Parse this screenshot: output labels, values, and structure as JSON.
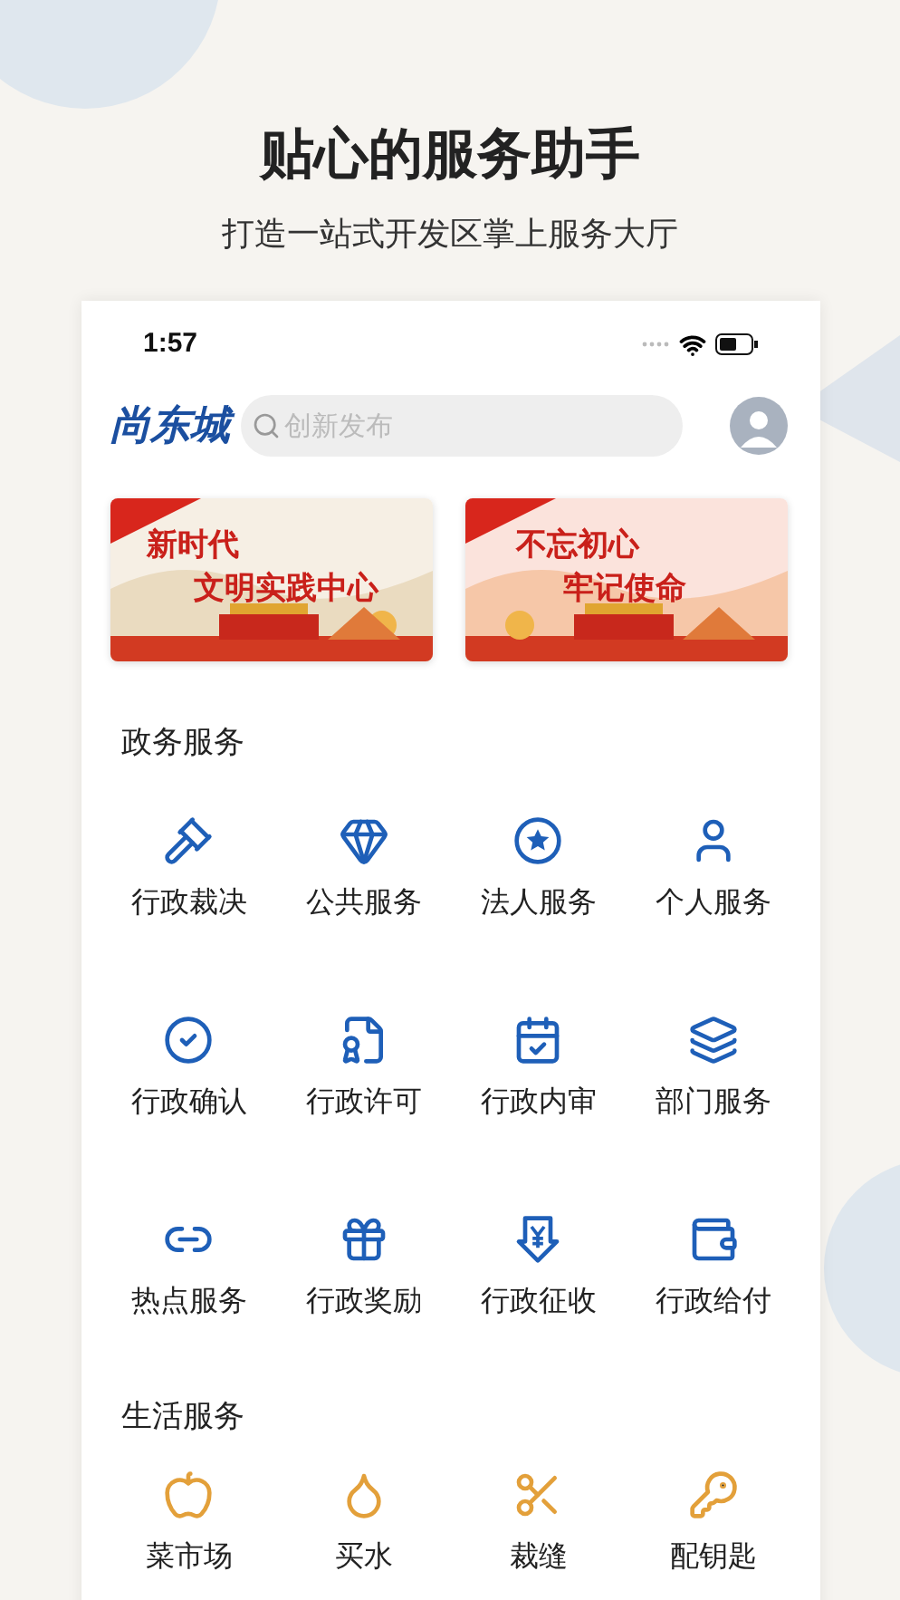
{
  "headline": "贴心的服务助手",
  "subtitle": "打造一站式开发区掌上服务大厅",
  "status_bar": {
    "time": "1:57"
  },
  "header": {
    "logo": "尚东城",
    "search": {
      "placeholder": "创新发布"
    }
  },
  "banners": [
    {
      "lines": [
        "新时代",
        "文明实践中心"
      ]
    },
    {
      "lines": [
        "不忘初心",
        "牢记使命"
      ]
    }
  ],
  "sections": [
    {
      "title": "政务服务",
      "items": [
        "行政裁决",
        "公共服务",
        "法人服务",
        "个人服务",
        "行政确认",
        "行政许可",
        "行政内审",
        "部门服务",
        "热点服务",
        "行政奖励",
        "行政征收",
        "行政给付"
      ]
    },
    {
      "title": "生活服务",
      "items": [
        "菜市场",
        "买水",
        "裁缝",
        "配钥匙"
      ]
    }
  ]
}
